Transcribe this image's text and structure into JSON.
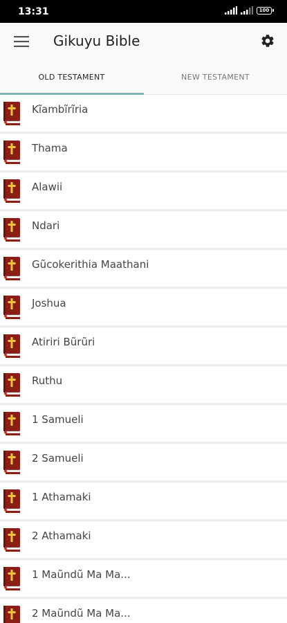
{
  "status_bar": {
    "time": "13:31",
    "battery": "100",
    "icons": [
      "signal-icon",
      "signal-icon",
      "battery-icon"
    ]
  },
  "app_bar": {
    "title": "Gikuyu Bible",
    "menu_icon": "menu-icon",
    "settings_icon": "gear-icon"
  },
  "tabs": [
    {
      "label": "OLD TESTAMENT",
      "selected": true
    },
    {
      "label": "NEW TESTAMENT",
      "selected": false
    }
  ],
  "colors": {
    "tab_indicator": "#7fb2b1",
    "book_icon": "#8a1f16",
    "cross": "#f0c040"
  },
  "books": [
    {
      "label": "Kĩambĩrĩria",
      "icon": "bible-book-icon"
    },
    {
      "label": "Thama",
      "icon": "bible-book-icon"
    },
    {
      "label": "Alawii",
      "icon": "bible-book-icon"
    },
    {
      "label": "Ndari",
      "icon": "bible-book-icon"
    },
    {
      "label": "Gũcokerithia Maathani",
      "icon": "bible-book-icon"
    },
    {
      "label": "Joshua",
      "icon": "bible-book-icon"
    },
    {
      "label": "Atiriri Bũrũri",
      "icon": "bible-book-icon"
    },
    {
      "label": "Ruthu",
      "icon": "bible-book-icon"
    },
    {
      "label": "1 Samueli",
      "icon": "bible-book-icon"
    },
    {
      "label": "2 Samueli",
      "icon": "bible-book-icon"
    },
    {
      "label": "1 Athamaki",
      "icon": "bible-book-icon"
    },
    {
      "label": "2 Athamaki",
      "icon": "bible-book-icon"
    },
    {
      "label": "1 Maũndũ Ma Ma...",
      "icon": "bible-book-icon"
    },
    {
      "label": "2 Maũndũ Ma Ma...",
      "icon": "bible-book-icon"
    }
  ]
}
